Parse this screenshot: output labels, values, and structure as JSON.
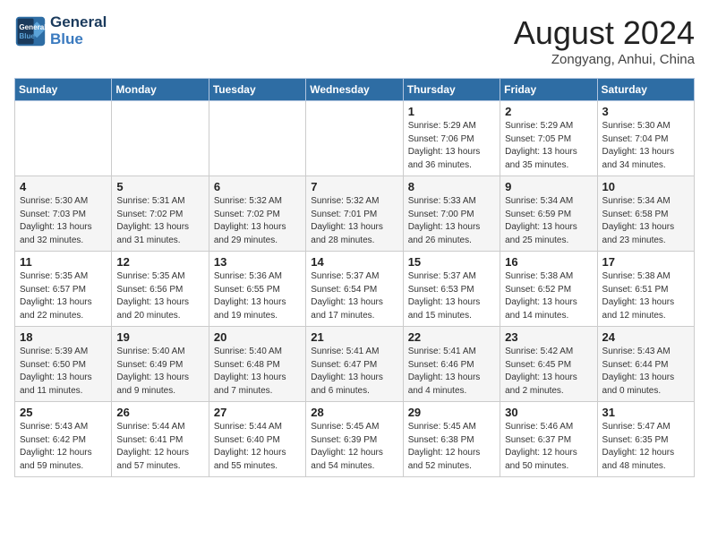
{
  "header": {
    "logo_line1": "General",
    "logo_line2": "Blue",
    "month_year": "August 2024",
    "location": "Zongyang, Anhui, China"
  },
  "weekdays": [
    "Sunday",
    "Monday",
    "Tuesday",
    "Wednesday",
    "Thursday",
    "Friday",
    "Saturday"
  ],
  "weeks": [
    [
      {
        "day": "",
        "info": ""
      },
      {
        "day": "",
        "info": ""
      },
      {
        "day": "",
        "info": ""
      },
      {
        "day": "",
        "info": ""
      },
      {
        "day": "1",
        "info": "Sunrise: 5:29 AM\nSunset: 7:06 PM\nDaylight: 13 hours\nand 36 minutes."
      },
      {
        "day": "2",
        "info": "Sunrise: 5:29 AM\nSunset: 7:05 PM\nDaylight: 13 hours\nand 35 minutes."
      },
      {
        "day": "3",
        "info": "Sunrise: 5:30 AM\nSunset: 7:04 PM\nDaylight: 13 hours\nand 34 minutes."
      }
    ],
    [
      {
        "day": "4",
        "info": "Sunrise: 5:30 AM\nSunset: 7:03 PM\nDaylight: 13 hours\nand 32 minutes."
      },
      {
        "day": "5",
        "info": "Sunrise: 5:31 AM\nSunset: 7:02 PM\nDaylight: 13 hours\nand 31 minutes."
      },
      {
        "day": "6",
        "info": "Sunrise: 5:32 AM\nSunset: 7:02 PM\nDaylight: 13 hours\nand 29 minutes."
      },
      {
        "day": "7",
        "info": "Sunrise: 5:32 AM\nSunset: 7:01 PM\nDaylight: 13 hours\nand 28 minutes."
      },
      {
        "day": "8",
        "info": "Sunrise: 5:33 AM\nSunset: 7:00 PM\nDaylight: 13 hours\nand 26 minutes."
      },
      {
        "day": "9",
        "info": "Sunrise: 5:34 AM\nSunset: 6:59 PM\nDaylight: 13 hours\nand 25 minutes."
      },
      {
        "day": "10",
        "info": "Sunrise: 5:34 AM\nSunset: 6:58 PM\nDaylight: 13 hours\nand 23 minutes."
      }
    ],
    [
      {
        "day": "11",
        "info": "Sunrise: 5:35 AM\nSunset: 6:57 PM\nDaylight: 13 hours\nand 22 minutes."
      },
      {
        "day": "12",
        "info": "Sunrise: 5:35 AM\nSunset: 6:56 PM\nDaylight: 13 hours\nand 20 minutes."
      },
      {
        "day": "13",
        "info": "Sunrise: 5:36 AM\nSunset: 6:55 PM\nDaylight: 13 hours\nand 19 minutes."
      },
      {
        "day": "14",
        "info": "Sunrise: 5:37 AM\nSunset: 6:54 PM\nDaylight: 13 hours\nand 17 minutes."
      },
      {
        "day": "15",
        "info": "Sunrise: 5:37 AM\nSunset: 6:53 PM\nDaylight: 13 hours\nand 15 minutes."
      },
      {
        "day": "16",
        "info": "Sunrise: 5:38 AM\nSunset: 6:52 PM\nDaylight: 13 hours\nand 14 minutes."
      },
      {
        "day": "17",
        "info": "Sunrise: 5:38 AM\nSunset: 6:51 PM\nDaylight: 13 hours\nand 12 minutes."
      }
    ],
    [
      {
        "day": "18",
        "info": "Sunrise: 5:39 AM\nSunset: 6:50 PM\nDaylight: 13 hours\nand 11 minutes."
      },
      {
        "day": "19",
        "info": "Sunrise: 5:40 AM\nSunset: 6:49 PM\nDaylight: 13 hours\nand 9 minutes."
      },
      {
        "day": "20",
        "info": "Sunrise: 5:40 AM\nSunset: 6:48 PM\nDaylight: 13 hours\nand 7 minutes."
      },
      {
        "day": "21",
        "info": "Sunrise: 5:41 AM\nSunset: 6:47 PM\nDaylight: 13 hours\nand 6 minutes."
      },
      {
        "day": "22",
        "info": "Sunrise: 5:41 AM\nSunset: 6:46 PM\nDaylight: 13 hours\nand 4 minutes."
      },
      {
        "day": "23",
        "info": "Sunrise: 5:42 AM\nSunset: 6:45 PM\nDaylight: 13 hours\nand 2 minutes."
      },
      {
        "day": "24",
        "info": "Sunrise: 5:43 AM\nSunset: 6:44 PM\nDaylight: 13 hours\nand 0 minutes."
      }
    ],
    [
      {
        "day": "25",
        "info": "Sunrise: 5:43 AM\nSunset: 6:42 PM\nDaylight: 12 hours\nand 59 minutes."
      },
      {
        "day": "26",
        "info": "Sunrise: 5:44 AM\nSunset: 6:41 PM\nDaylight: 12 hours\nand 57 minutes."
      },
      {
        "day": "27",
        "info": "Sunrise: 5:44 AM\nSunset: 6:40 PM\nDaylight: 12 hours\nand 55 minutes."
      },
      {
        "day": "28",
        "info": "Sunrise: 5:45 AM\nSunset: 6:39 PM\nDaylight: 12 hours\nand 54 minutes."
      },
      {
        "day": "29",
        "info": "Sunrise: 5:45 AM\nSunset: 6:38 PM\nDaylight: 12 hours\nand 52 minutes."
      },
      {
        "day": "30",
        "info": "Sunrise: 5:46 AM\nSunset: 6:37 PM\nDaylight: 12 hours\nand 50 minutes."
      },
      {
        "day": "31",
        "info": "Sunrise: 5:47 AM\nSunset: 6:35 PM\nDaylight: 12 hours\nand 48 minutes."
      }
    ]
  ]
}
